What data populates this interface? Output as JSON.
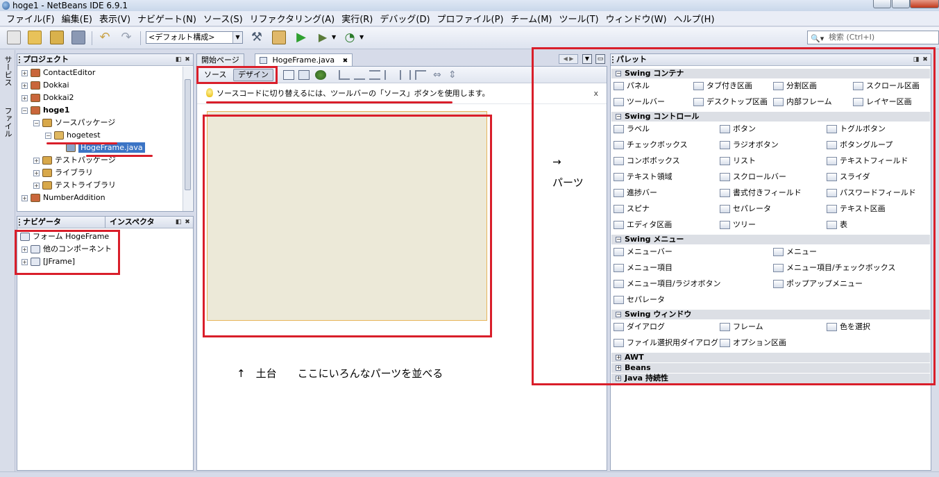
{
  "window": {
    "title": "hoge1 - NetBeans IDE 6.9.1"
  },
  "menu": [
    "ファイル(F)",
    "編集(E)",
    "表示(V)",
    "ナビゲート(N)",
    "ソース(S)",
    "リファクタリング(A)",
    "実行(R)",
    "デバッグ(D)",
    "プロファイル(P)",
    "チーム(M)",
    "ツール(T)",
    "ウィンドウ(W)",
    "ヘルプ(H)"
  ],
  "toolbar": {
    "config_value": "<デフォルト構成>",
    "search_placeholder": "検索 (Ctrl+I)"
  },
  "left_strip": {
    "services_label": "サービス",
    "files_label": "ファイル"
  },
  "projects": {
    "title": "プロジェクト",
    "items": [
      {
        "label": "ContactEditor",
        "level": 0,
        "expander": "+"
      },
      {
        "label": "Dokkai",
        "level": 0,
        "expander": "+"
      },
      {
        "label": "Dokkai2",
        "level": 0,
        "expander": "+"
      },
      {
        "label": "hoge1",
        "level": 0,
        "expander": "-"
      },
      {
        "label": "ソースパッケージ",
        "level": 1,
        "expander": "-"
      },
      {
        "label": "hogetest",
        "level": 2,
        "expander": "-"
      },
      {
        "label": "HogeFrame.java",
        "level": 3,
        "expander": ""
      },
      {
        "label": "テストパッケージ",
        "level": 1,
        "expander": "+"
      },
      {
        "label": "ライブラリ",
        "level": 1,
        "expander": "+"
      },
      {
        "label": "テストライブラリ",
        "level": 1,
        "expander": "+"
      },
      {
        "label": "NumberAddition",
        "level": 0,
        "expander": "+"
      }
    ]
  },
  "navigator": {
    "tab_navigator": "ナビゲータ",
    "tab_inspector": "インスペクタ",
    "items": [
      {
        "label": "フォーム HogeFrame",
        "level": 0
      },
      {
        "label": "他のコンポーネント",
        "level": 1
      },
      {
        "label": "[JFrame]",
        "level": 1
      }
    ]
  },
  "editor": {
    "tabs": [
      "開始ページ",
      "HogeFrame.java"
    ],
    "source_button": "ソース",
    "design_button": "デザイン",
    "hint": "ソースコードに切り替えるには、ツールバーの「ソース」ボタンを使用します。",
    "hint_close": "x",
    "annotation_arrow_right": "→",
    "annotation_parts": "パーツ",
    "annotation_base": "↑　土台　　ここにいろんなパーツを並べる"
  },
  "palette": {
    "title": "パレット",
    "categories": [
      {
        "label": "Swing コンテナ",
        "expander": "-",
        "rows": [
          [
            "パネル",
            "タブ付き区画",
            "分割区画",
            "スクロール区画"
          ],
          [
            "ツールバー",
            "デスクトップ区画",
            "内部フレーム",
            "レイヤー区画"
          ]
        ]
      },
      {
        "label": "Swing コントロール",
        "expander": "-",
        "rows": [
          [
            "ラベル",
            "ボタン",
            "トグルボタン"
          ],
          [
            "チェックボックス",
            "ラジオボタン",
            "ボタングループ"
          ],
          [
            "コンボボックス",
            "リスト",
            "テキストフィールド"
          ],
          [
            "テキスト領域",
            "スクロールバー",
            "スライダ"
          ],
          [
            "進捗バー",
            "書式付きフィールド",
            "パスワードフィールド"
          ],
          [
            "スピナ",
            "セパレータ",
            "テキスト区画"
          ],
          [
            "エディタ区画",
            "ツリー",
            "表"
          ]
        ]
      },
      {
        "label": "Swing メニュー",
        "expander": "-",
        "rows": [
          [
            "メニューバー",
            "メニュー"
          ],
          [
            "メニュー項目",
            "メニュー項目/チェックボックス"
          ],
          [
            "メニュー項目/ラジオボタン",
            "ポップアップメニュー"
          ],
          [
            "セパレータ"
          ]
        ]
      },
      {
        "label": "Swing ウィンドウ",
        "expander": "-",
        "rows": [
          [
            "ダイアログ",
            "フレーム",
            "色を選択"
          ],
          [
            "ファイル選択用ダイアログ",
            "オプション区画"
          ]
        ]
      },
      {
        "label": "AWT",
        "expander": "+",
        "rows": []
      },
      {
        "label": "Beans",
        "expander": "+",
        "rows": []
      },
      {
        "label": "Java 持続性",
        "expander": "+",
        "rows": []
      }
    ]
  }
}
